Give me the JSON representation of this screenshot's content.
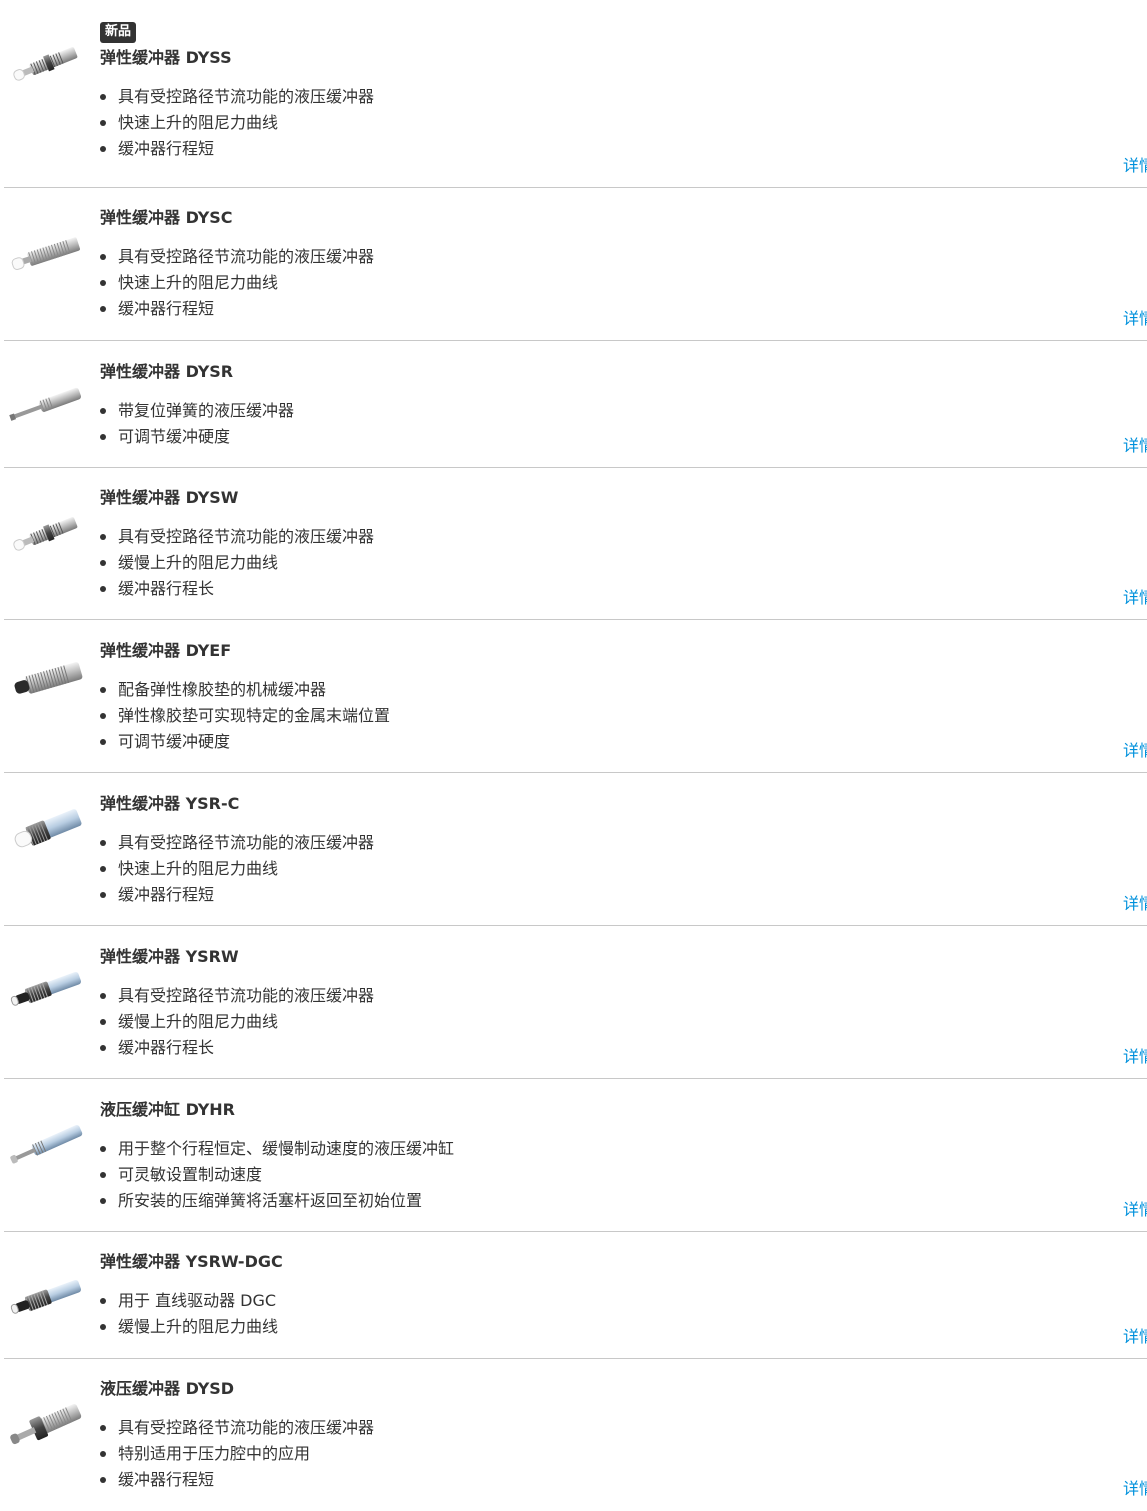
{
  "products": [
    {
      "badge": "新品",
      "title": "弹性缓冲器 DYSS",
      "features": [
        "具有受控路径节流功能的液压缓冲器",
        "快速上升的阻尼力曲线",
        "缓冲器行程短"
      ],
      "details": "详情",
      "image": "short-black-thread-white-tip"
    },
    {
      "badge": "",
      "title": "弹性缓冲器 DYSC",
      "features": [
        "具有受控路径节流功能的液压缓冲器",
        "快速上升的阻尼力曲线",
        "缓冲器行程短"
      ],
      "details": "详情",
      "image": "silver-thread-white-tip"
    },
    {
      "badge": "",
      "title": "弹性缓冲器 DYSR",
      "features": [
        "带复位弹簧的液压缓冲器",
        "可调节缓冲硬度"
      ],
      "details": "详情",
      "image": "long-silver-rod"
    },
    {
      "badge": "",
      "title": "弹性缓冲器 DYSW",
      "features": [
        "具有受控路径节流功能的液压缓冲器",
        "缓慢上升的阻尼力曲线",
        "缓冲器行程长"
      ],
      "details": "详情",
      "image": "short-black-thread-white-tip"
    },
    {
      "badge": "",
      "title": "弹性缓冲器 DYEF",
      "features": [
        "配备弹性橡胶垫的机械缓冲器",
        "弹性橡胶垫可实现特定的金属末端位置",
        "可调节缓冲硬度"
      ],
      "details": "详情",
      "image": "silver-thread-black-tip"
    },
    {
      "badge": "",
      "title": "弹性缓冲器 YSR-C",
      "features": [
        "具有受控路径节流功能的液压缓冲器",
        "快速上升的阻尼力曲线",
        "缓冲器行程短"
      ],
      "details": "详情",
      "image": "silver-body-white-cap"
    },
    {
      "badge": "",
      "title": "弹性缓冲器 YSRW",
      "features": [
        "具有受控路径节流功能的液压缓冲器",
        "缓慢上升的阻尼力曲线",
        "缓冲器行程长"
      ],
      "details": "详情",
      "image": "dark-thread-blue-body"
    },
    {
      "badge": "",
      "title": "液压缓冲缸 DYHR",
      "features": [
        "用于整个行程恒定、缓慢制动速度的液压缓冲缸",
        "可灵敏设置制动速度",
        "所安装的压缩弹簧将活塞杆返回至初始位置"
      ],
      "details": "详情",
      "image": "long-silver-cylinder"
    },
    {
      "badge": "",
      "title": "弹性缓冲器 YSRW-DGC",
      "features": [
        "用于 直线驱动器 DGC",
        "缓慢上升的阻尼力曲线"
      ],
      "details": "详情",
      "image": "dark-thread-blue-body"
    },
    {
      "badge": "",
      "title": "液压缓冲器 DYSD",
      "features": [
        "具有受控路径节流功能的液压缓冲器",
        "特别适用于压力腔中的应用",
        "缓冲器行程短"
      ],
      "details": "详情",
      "image": "silver-rod-with-nut"
    }
  ]
}
